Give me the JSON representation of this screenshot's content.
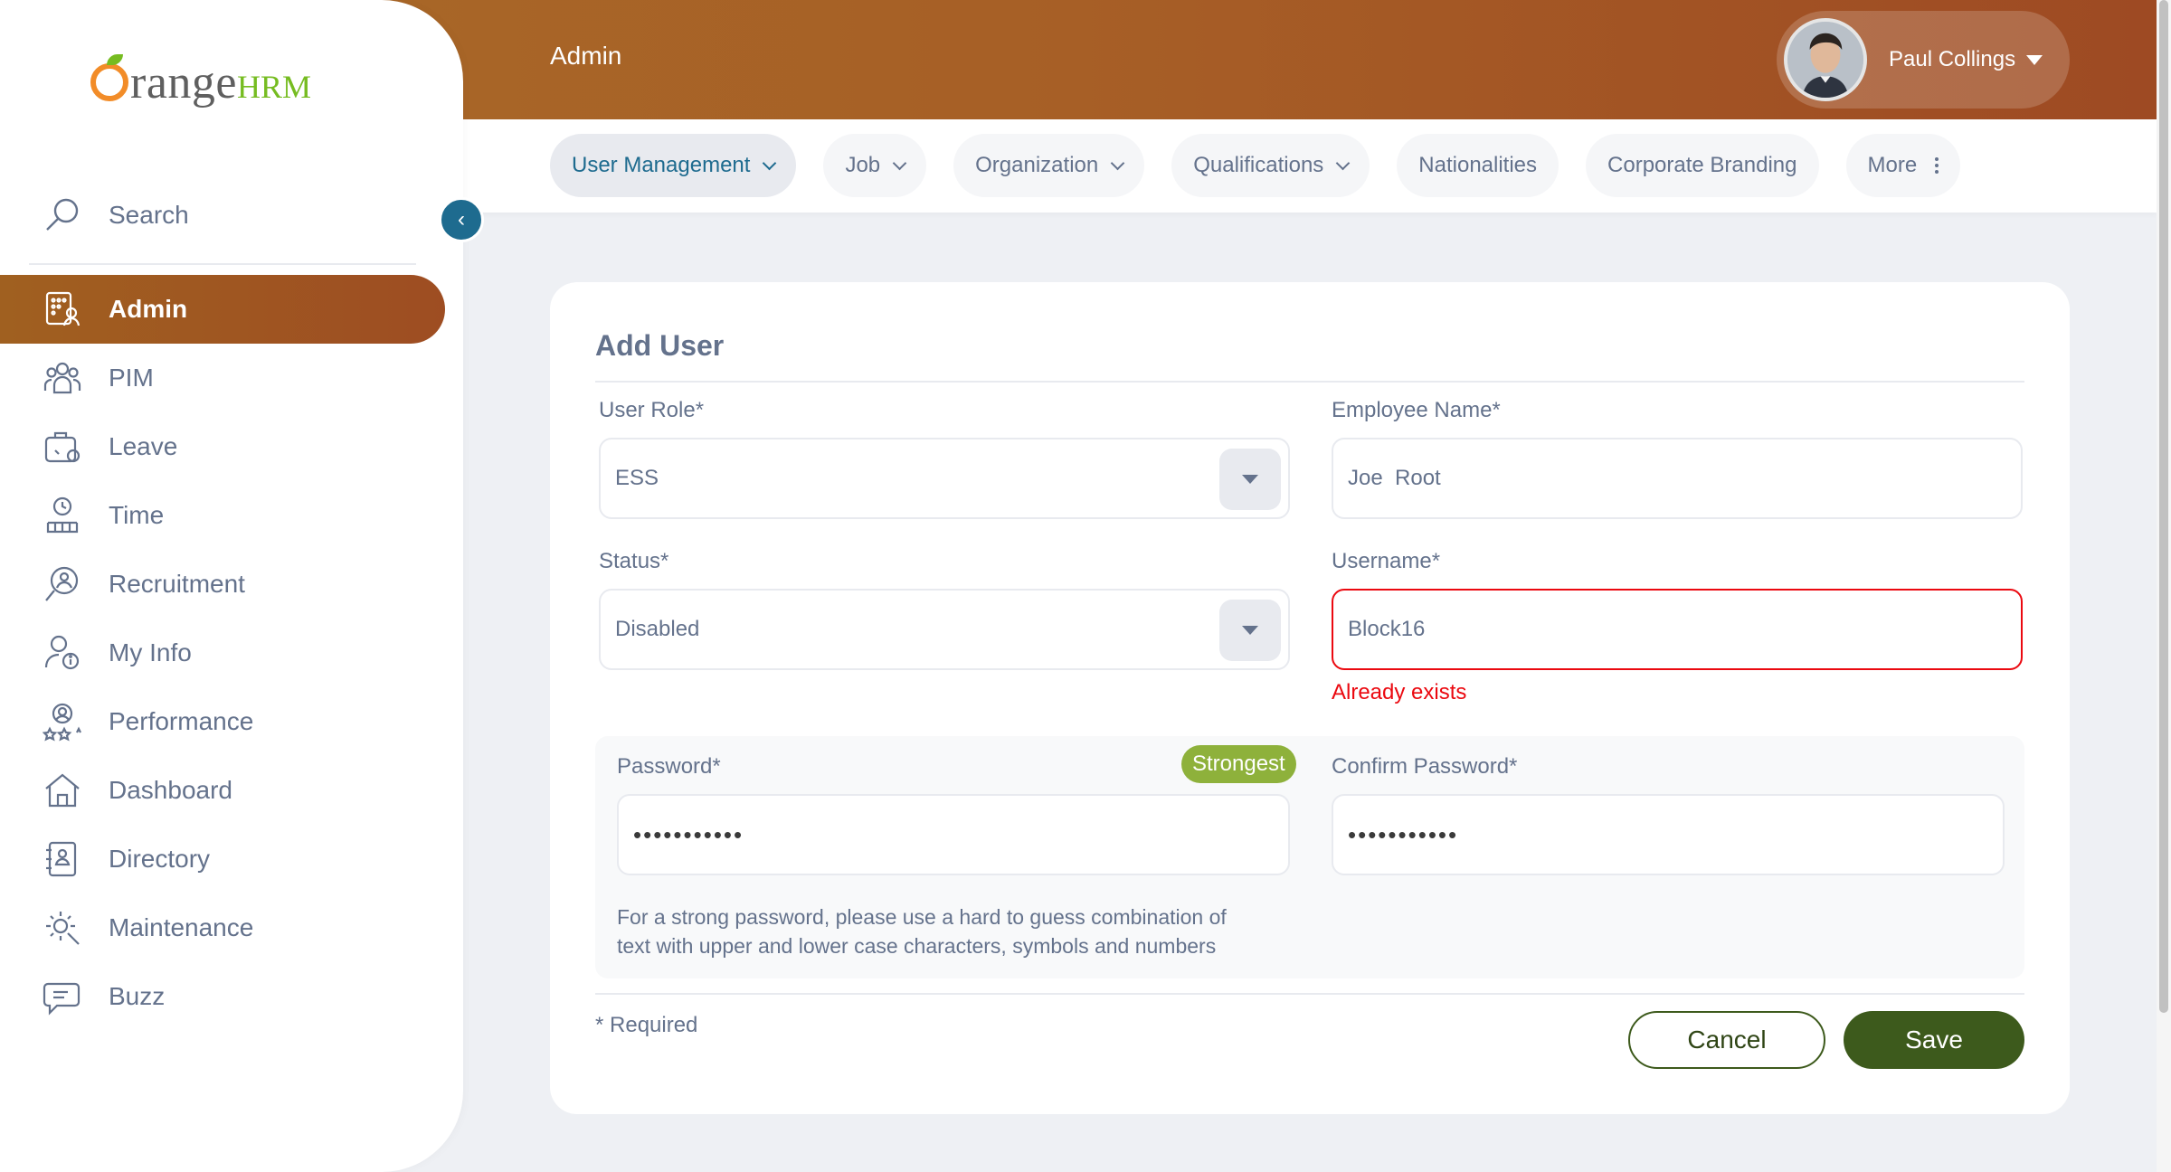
{
  "brand": {
    "logo_main": "range",
    "logo_suffix": "HRM"
  },
  "sidebar": {
    "search_label": "Search",
    "items": [
      {
        "label": "Admin",
        "icon": "admin-icon",
        "active": true
      },
      {
        "label": "PIM",
        "icon": "pim-icon"
      },
      {
        "label": "Leave",
        "icon": "leave-icon"
      },
      {
        "label": "Time",
        "icon": "time-icon"
      },
      {
        "label": "Recruitment",
        "icon": "recruitment-icon"
      },
      {
        "label": "My Info",
        "icon": "my-info-icon"
      },
      {
        "label": "Performance",
        "icon": "performance-icon"
      },
      {
        "label": "Dashboard",
        "icon": "dashboard-icon"
      },
      {
        "label": "Directory",
        "icon": "directory-icon"
      },
      {
        "label": "Maintenance",
        "icon": "maintenance-icon"
      },
      {
        "label": "Buzz",
        "icon": "buzz-icon"
      }
    ]
  },
  "header": {
    "title": "Admin",
    "user_name": "Paul Collings"
  },
  "tabs": {
    "user_management": "User Management",
    "job": "Job",
    "organization": "Organization",
    "qualifications": "Qualifications",
    "nationalities": "Nationalities",
    "corporate_branding": "Corporate Branding",
    "more": "More"
  },
  "form": {
    "title": "Add User",
    "user_role": {
      "label": "User Role*",
      "value": "ESS"
    },
    "employee_name": {
      "label": "Employee Name*",
      "value": "Joe  Root"
    },
    "status": {
      "label": "Status*",
      "value": "Disabled"
    },
    "username": {
      "label": "Username*",
      "value": "Block16",
      "error": "Already exists"
    },
    "password": {
      "label": "Password*",
      "value": "•••••••••••",
      "strength": "Strongest"
    },
    "confirm_password": {
      "label": "Confirm Password*",
      "value": "•••••••••••"
    },
    "hint_line1": "For a strong password, please use a hard to guess combination of",
    "hint_line2": "text with upper and lower case characters, symbols and numbers",
    "required_note": "* Required",
    "cancel_label": "Cancel",
    "save_label": "Save"
  },
  "colors": {
    "accent_orange": "#a0561f",
    "primary_green": "#3d5a1c",
    "error_red": "#eb0910",
    "strength_green": "#8eb13b",
    "tab_active_text": "#1e6b8f"
  }
}
